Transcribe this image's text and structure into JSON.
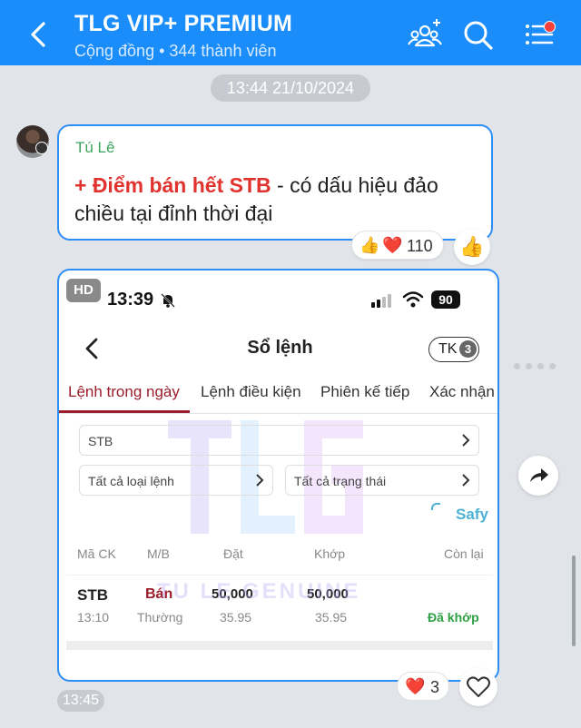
{
  "header": {
    "title": "TLG VIP+ PREMIUM",
    "subtitle": "Cộng đồng • 344 thành viên",
    "icons": [
      "back-icon",
      "add-members-icon",
      "search-icon",
      "menu-icon"
    ]
  },
  "date_separator": "13:44 21/10/2024",
  "message1": {
    "sender": "Tú Lê",
    "highlight": "+ Điểm bán hết STB",
    "text": " - có dấu hiệu đảo chiều tại đỉnh thời đại",
    "reactions": {
      "thumbs": "👍",
      "heart": "❤️",
      "count": "110"
    },
    "like_icon": "👍"
  },
  "message2": {
    "hd_label": "HD",
    "screenshot": {
      "time": "13:39",
      "battery": "90",
      "page_title": "Sổ lệnh",
      "account_label": "TK",
      "account_count": "3",
      "tabs": [
        "Lệnh trong ngày",
        "Lệnh điều kiện",
        "Phiên kế tiếp",
        "Xác nhận l"
      ],
      "filters": {
        "symbol": "STB",
        "order_type": "Tất cả loại lệnh",
        "status": "Tất cả trạng thái"
      },
      "brand": "Safy",
      "watermark": "TU LE GENUINE",
      "columns": [
        "Mã CK",
        "M/B",
        "Đặt",
        "Khớp",
        "Còn lại"
      ],
      "order": {
        "symbol": "STB",
        "time": "13:10",
        "side": "Bán",
        "side_sub": "Thường",
        "placed_qty": "50,000",
        "placed_price": "35.95",
        "matched_qty": "50,000",
        "matched_price": "35.95",
        "status": "Đã khớp"
      }
    },
    "reaction": {
      "heart": "❤️",
      "count": "3"
    },
    "time": "13:45"
  },
  "colors": {
    "header": "#1a8dfb",
    "bubble_border": "#2d8ef6",
    "sell": "#9b1c2a",
    "matched": "#2ea043",
    "highlight": "#e0332f"
  }
}
